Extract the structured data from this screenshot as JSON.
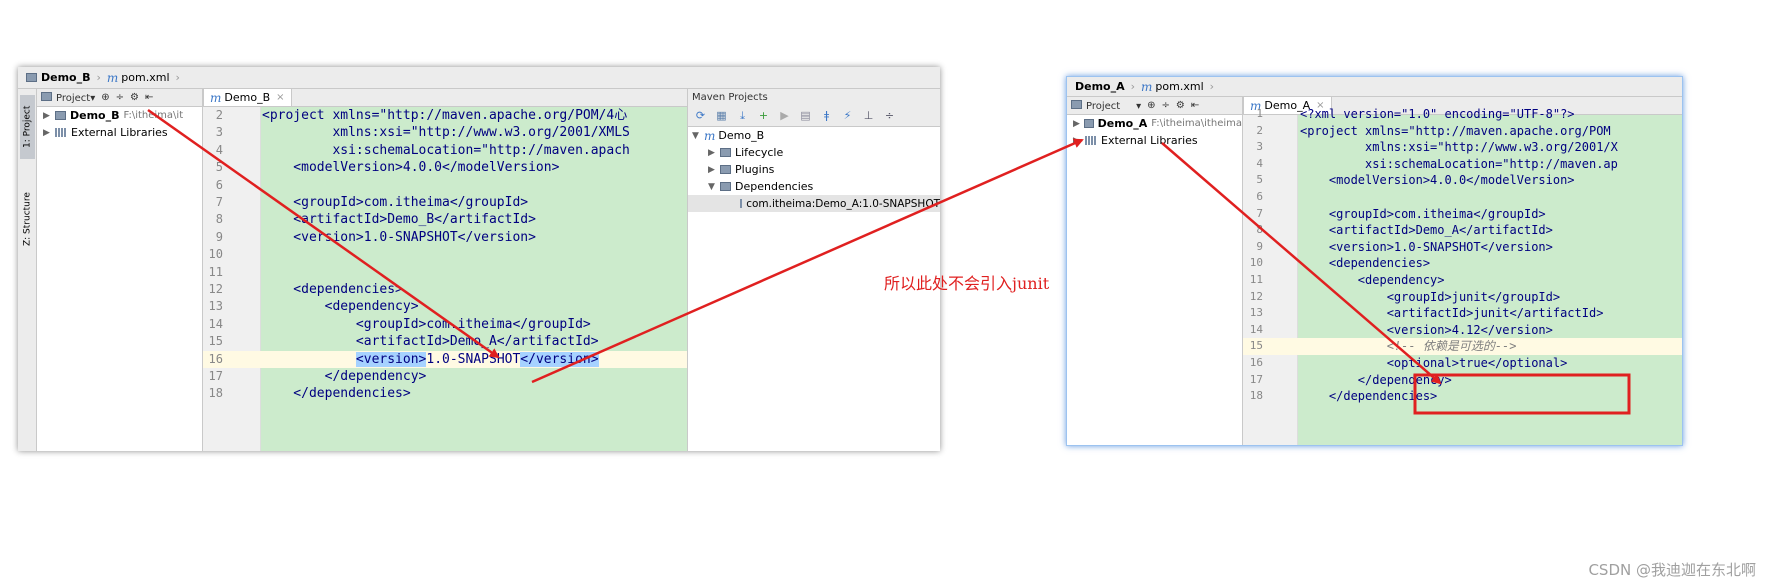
{
  "left": {
    "breadcrumb": {
      "project": "Demo_B",
      "file": "pom.xml"
    },
    "side_tabs": {
      "project": "1: Project",
      "structure": "Z: Structure"
    },
    "project_tool": {
      "view": "Project"
    },
    "tree": [
      {
        "label": "Demo_B",
        "path": "F:\\itheima\\it"
      },
      {
        "label": "External Libraries",
        "path": ""
      }
    ],
    "editor_tab": "Demo_B",
    "code_lines": [
      {
        "num": "2",
        "text": "<project xmlns=\"http://maven.apache.org/POM/4心"
      },
      {
        "num": "3",
        "text": "         xmlns:xsi=\"http://www.w3.org/2001/XMLS"
      },
      {
        "num": "4",
        "text": "         xsi:schemaLocation=\"http://maven.apach"
      },
      {
        "num": "5",
        "text": "    <modelVersion>4.0.0</modelVersion>"
      },
      {
        "num": "6",
        "text": ""
      },
      {
        "num": "7",
        "text": "    <groupId>com.itheima</groupId>"
      },
      {
        "num": "8",
        "text": "    <artifactId>Demo_B</artifactId>"
      },
      {
        "num": "9",
        "text": "    <version>1.0-SNAPSHOT</version>"
      },
      {
        "num": "10",
        "text": ""
      },
      {
        "num": "11",
        "text": ""
      },
      {
        "num": "12",
        "text": "    <dependencies>"
      },
      {
        "num": "13",
        "text": "        <dependency>"
      },
      {
        "num": "14",
        "text": "            <groupId>com.itheima</groupId>"
      },
      {
        "num": "15",
        "text": "            <artifactId>Demo_A</artifactId>"
      },
      {
        "num": "16",
        "text_pre": "            ",
        "text_sel1": "<version>",
        "text_mid": "1.0-SNAPSHOT",
        "text_sel2": "</version>"
      },
      {
        "num": "17",
        "text": "        </dependency>"
      },
      {
        "num": "18",
        "text": "    </dependencies>"
      }
    ],
    "maven": {
      "title": "Maven Projects",
      "tree": [
        {
          "label": "Demo_B"
        },
        {
          "label": "Lifecycle"
        },
        {
          "label": "Plugins"
        },
        {
          "label": "Dependencies"
        },
        {
          "label": "com.itheima:Demo_A:1.0-SNAPSHOT"
        }
      ]
    }
  },
  "right": {
    "breadcrumb": {
      "project": "Demo_A",
      "file": "pom.xml"
    },
    "project_tool": {
      "view": "Project"
    },
    "tree": [
      {
        "label": "Demo_A",
        "path": "F:\\itheima\\itheima"
      },
      {
        "label": "External Libraries",
        "path": ""
      }
    ],
    "editor_tab": "Demo_A",
    "code_lines": [
      {
        "num": "1",
        "text": "<?xml version=\"1.0\" encoding=\"UTF-8\"?>"
      },
      {
        "num": "2",
        "text": "<project xmlns=\"http://maven.apache.org/POM"
      },
      {
        "num": "3",
        "text": "         xmlns:xsi=\"http://www.w3.org/2001/X"
      },
      {
        "num": "4",
        "text": "         xsi:schemaLocation=\"http://maven.ap"
      },
      {
        "num": "5",
        "text": "    <modelVersion>4.0.0</modelVersion>"
      },
      {
        "num": "6",
        "text": ""
      },
      {
        "num": "7",
        "text": "    <groupId>com.itheima</groupId>"
      },
      {
        "num": "8",
        "text": "    <artifactId>Demo_A</artifactId>"
      },
      {
        "num": "9",
        "text": "    <version>1.0-SNAPSHOT</version>"
      },
      {
        "num": "10",
        "text": "    <dependencies>"
      },
      {
        "num": "11",
        "text": "        <dependency>"
      },
      {
        "num": "12",
        "text": "            <groupId>junit</groupId>"
      },
      {
        "num": "13",
        "text": "            <artifactId>junit</artifactId>"
      },
      {
        "num": "14",
        "text": "            <version>4.12</version>"
      },
      {
        "num": "15",
        "text_pre": "            ",
        "comment": "<!-- 依赖是可选的-->"
      },
      {
        "num": "16",
        "text": "            <optional>true</optional>"
      },
      {
        "num": "17",
        "text": "        </dependency>"
      },
      {
        "num": "18",
        "text": "    </dependencies>"
      }
    ]
  },
  "annotation": "所以此处不会引入junit",
  "watermark": "CSDN @我迪迦在东北啊",
  "colors": {
    "arrow": "#e02020",
    "code_bg": "#ccebcc",
    "selection": "#a6d2ff",
    "highlight_box": "#e02020"
  }
}
